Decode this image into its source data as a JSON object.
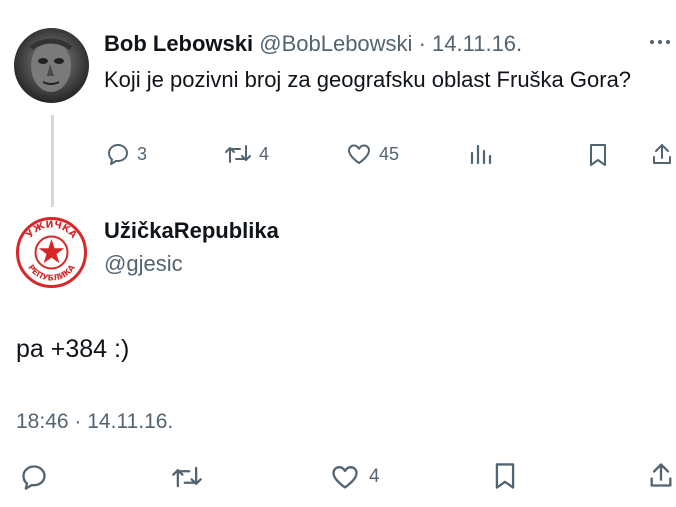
{
  "parent_tweet": {
    "author_name": "Bob Lebowski",
    "handle": "@BobLebowski",
    "separator": "·",
    "date": "14.11.16.",
    "text": "Koji je pozivni broj za geografsku oblast Fruška Gora?",
    "replies": "3",
    "retweets": "4",
    "likes": "45"
  },
  "reply_tweet": {
    "author_name": "UžičkaRepublika",
    "handle": "@gjesic",
    "text": "pa +384 :)",
    "time": "18:46",
    "separator": "·",
    "date": "14.11.16.",
    "likes": "4",
    "avatar_text_top": "УЖИЧКА",
    "avatar_text_bottom": "РЕПУБЛИКА"
  },
  "colors": {
    "text": "#0f1419",
    "muted": "#536471",
    "thread_line": "#cfd9de",
    "logo_red": "#d62828"
  },
  "icons": [
    "more-icon",
    "reply-icon",
    "retweet-icon",
    "like-icon",
    "views-icon",
    "bookmark-icon",
    "share-icon"
  ]
}
